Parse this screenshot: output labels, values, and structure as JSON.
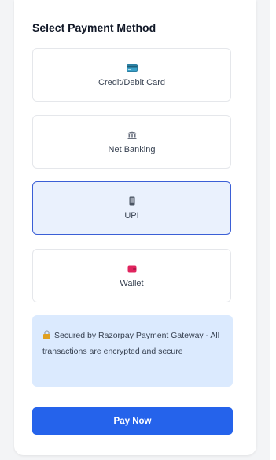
{
  "payment": {
    "title": "Select Payment Method",
    "methods": [
      {
        "label": "Credit/Debit Card",
        "icon": "credit-card-icon",
        "selected": false
      },
      {
        "label": "Net Banking",
        "icon": "bank-icon",
        "selected": false
      },
      {
        "label": "UPI",
        "icon": "phone-icon",
        "selected": true
      },
      {
        "label": "Wallet",
        "icon": "wallet-icon",
        "selected": false
      }
    ],
    "notice": "Secured by Razorpay Payment Gateway - All transactions are encrypted and secure",
    "pay_button": "Pay Now"
  },
  "colors": {
    "accent": "#2563eb",
    "selected_bg": "#eaf1fd",
    "selected_border": "#3b5fd6",
    "notice_bg": "#dbeafe"
  }
}
